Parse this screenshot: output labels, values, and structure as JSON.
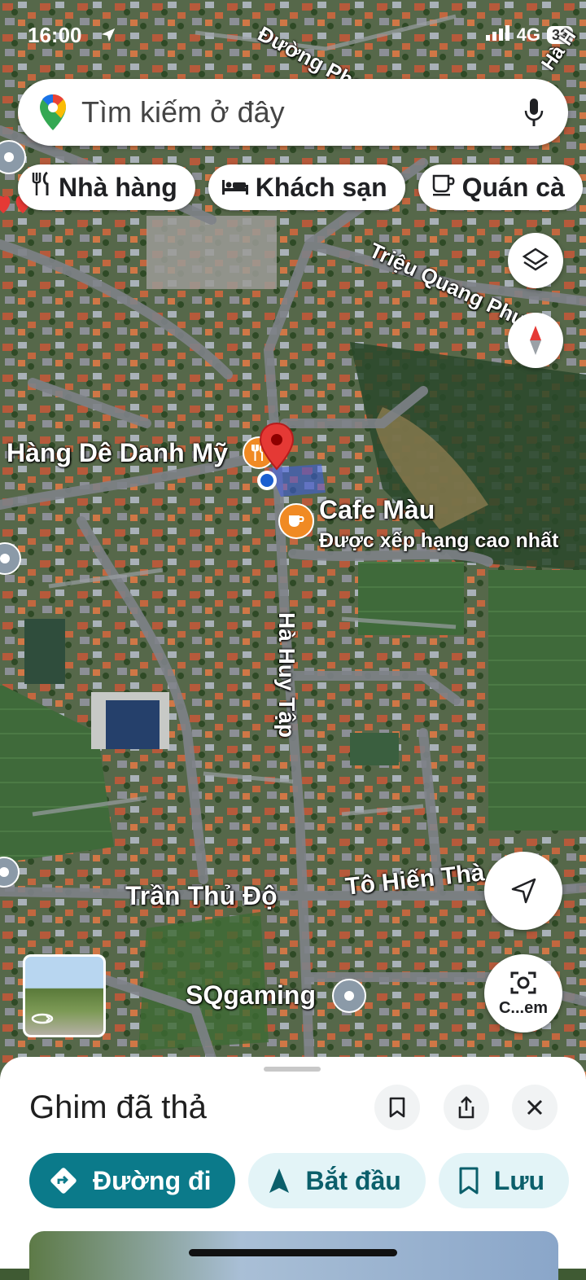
{
  "status_bar": {
    "time": "16:00",
    "network": "4G",
    "battery": "33"
  },
  "search": {
    "placeholder": "Tìm kiếm ở đây"
  },
  "chips": [
    {
      "label": "Nhà hàng",
      "icon": "fork-knife-icon"
    },
    {
      "label": "Khách sạn",
      "icon": "bed-icon"
    },
    {
      "label": "Quán cà",
      "icon": "coffee-cup-icon"
    }
  ],
  "map_labels": {
    "road_pham": "Đường Phạm",
    "road_hah": "Hà H",
    "road_trieu": "Triệu Quang Phục",
    "road_ha_huy_tap": "Hà Huy Tập",
    "road_tran_thu_do": "Trần Thủ Độ",
    "road_to_hien": "Tô Hiến Thà",
    "place_hang_de": "Hàng Dê Danh Mỹ",
    "place_cafe": "Cafe Màu",
    "place_cafe_sub": "Được xếp hạng cao nhất",
    "place_sqgaming": "SQgaming"
  },
  "camera_button": {
    "label": "C...em"
  },
  "sheet": {
    "title": "Ghim đã thả",
    "actions": [
      {
        "label": "Đường đi",
        "icon": "directions-icon"
      },
      {
        "label": "Bắt đầu",
        "icon": "navigation-arrow-icon"
      },
      {
        "label": "Lưu",
        "icon": "bookmark-icon"
      }
    ]
  },
  "colors": {
    "primary": "#0b7a8a",
    "secondary_bg": "#e3f4f7",
    "pin": "#e53935",
    "place_orange": "#f08a24"
  }
}
